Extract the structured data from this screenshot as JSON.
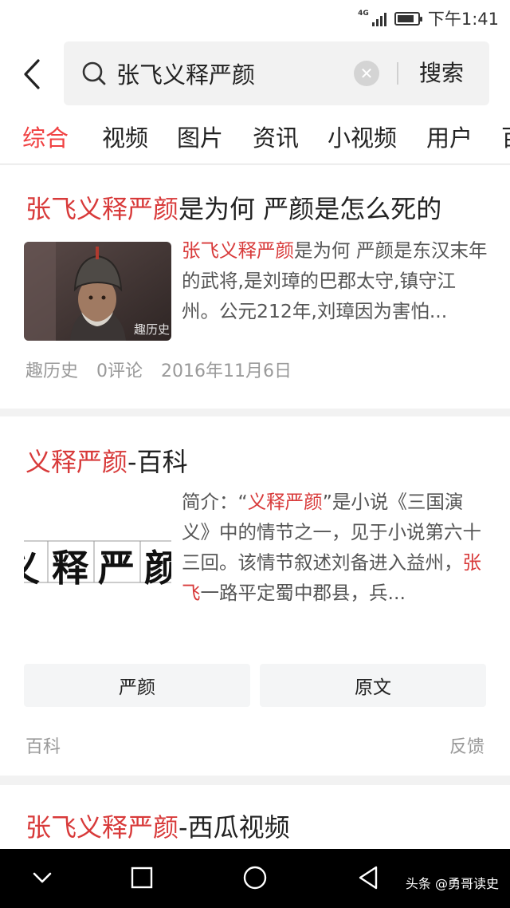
{
  "status_bar": {
    "network": "4G",
    "time": "下午1:41"
  },
  "search": {
    "query": "张飞义释严颜",
    "submit_label": "搜索"
  },
  "tabs": [
    {
      "label": "综合",
      "active": true
    },
    {
      "label": "视频"
    },
    {
      "label": "图片"
    },
    {
      "label": "资讯"
    },
    {
      "label": "小视频"
    },
    {
      "label": "用户"
    },
    {
      "label": "百"
    }
  ],
  "results": [
    {
      "title_hl": "张飞义释严颜",
      "title_rest": "是为何 严颜是怎么死的",
      "snippet_hl": "张飞义释严颜",
      "snippet_rest": "是为何 严颜是东汉末年的武将,是刘璋的巴郡太守,镇守江州。公元212年,刘璋因为害怕...",
      "thumb_watermark": "趣历史",
      "source": "趣历史",
      "comments": "0评论",
      "date": "2016年11月6日"
    },
    {
      "title_hl": "义释严颜",
      "title_rest": "-百科",
      "image_chars": [
        "义",
        "释",
        "严",
        "颜"
      ],
      "snippet_prefix": "简介：“",
      "snippet_hl1": "义释严颜",
      "snippet_mid": "”是小说《三国演义》中的情节之一，见于小说第六十三回。该情节叙述刘备进入益州，",
      "snippet_hl2": "张飞",
      "snippet_end": "一路平定蜀中郡县，兵...",
      "buttons": [
        "严颜",
        "原文"
      ],
      "source": "百科",
      "feedback": "反馈"
    },
    {
      "title_hl": "张飞义释严颜",
      "title_rest": "-西瓜视频"
    }
  ],
  "watermark": "头条 @勇哥读史",
  "colors": {
    "accent": "#f04142",
    "highlight": "#d83a3a",
    "meta": "#999999"
  }
}
